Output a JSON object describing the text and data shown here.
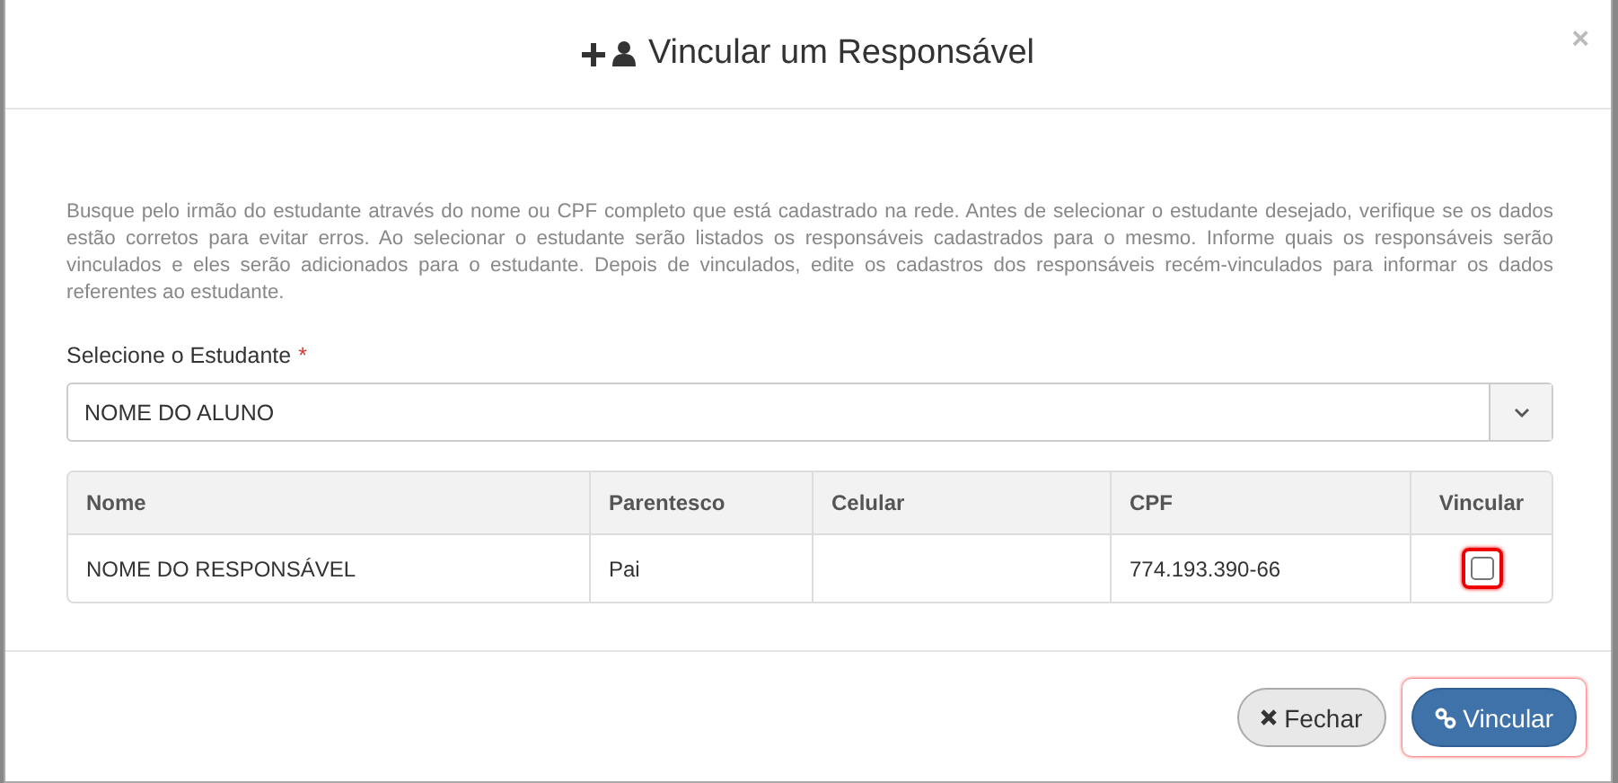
{
  "modal": {
    "title": "Vincular um Responsável",
    "close": "×",
    "description": "Busque pelo irmão do estudante através do nome ou CPF completo que está cadastrado na rede. Antes de selecionar o estudante desejado, verifique se os dados estão corretos para evitar erros. Ao selecionar o estudante serão listados os responsáveis cadastrados para o mesmo. Informe quais os responsáveis serão vinculados e eles serão adicionados para o estudante. Depois de vinculados, edite os cadastros dos responsáveis recém-vinculados para informar os dados referentes ao estudante.",
    "student_field": {
      "label": "Selecione o Estudante",
      "required_mark": "*",
      "value": "NOME DO ALUNO"
    },
    "table": {
      "columns": [
        "Nome",
        "Parentesco",
        "Celular",
        "CPF",
        "Vincular"
      ],
      "rows": [
        {
          "cells": [
            "NOME DO RESPONSÁVEL",
            "Pai",
            "",
            "774.193.390-66"
          ],
          "checked": false,
          "highlighted": true
        }
      ]
    },
    "buttons": [
      {
        "kind": "default",
        "label": "Fechar",
        "highlighted": false
      },
      {
        "kind": "primary",
        "label": "Vincular",
        "highlighted": true
      }
    ]
  }
}
